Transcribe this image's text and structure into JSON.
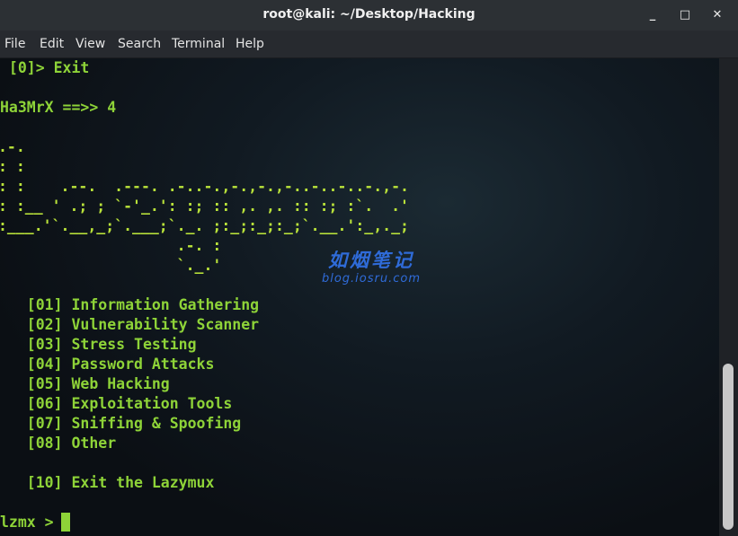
{
  "window": {
    "title": "root@kali: ~/Desktop/Hacking",
    "minimize_glyph": "_",
    "maximize_glyph": "□",
    "close_glyph": "✕"
  },
  "menu": [
    "File",
    "Edit",
    "View",
    "Search",
    "Terminal",
    "Help"
  ],
  "terminal": {
    "exit_option": " [0]> Exit",
    "prompt_line": "Ha3MrX ==>> 4",
    "ascii_art": [
      ".-.",
      ": :",
      ": :    .--.  .---. .-..-.,-.,-.,-..-..-..-.,-.",
      ": :__ ' .; ; `-'_.': :; :: ,. ,. :: :; :`.  .'",
      ":___.'`.__,_;`.___;`._. ;:_;:_;:_;`.__.':_,._;",
      "                    .-. :",
      "                    `._.'"
    ],
    "options": [
      "   [01] Information Gathering",
      "   [02] Vulnerability Scanner",
      "   [03] Stress Testing",
      "   [04] Password Attacks",
      "   [05] Web Hacking",
      "   [06] Exploitation Tools",
      "   [07] Sniffing & Spoofing",
      "   [08] Other"
    ],
    "exit_lazymux": "   [10] Exit the Lazymux",
    "input_prompt": "lzmx > "
  },
  "watermark": {
    "title": "如烟笔记",
    "url": "blog.iosru.com",
    "color": "#2f6bd8"
  },
  "colors": {
    "terminal_text": "#8ed338",
    "ascii_art": "#b9e23a",
    "titlebar": "#2c3034",
    "background": "#0d1116"
  }
}
